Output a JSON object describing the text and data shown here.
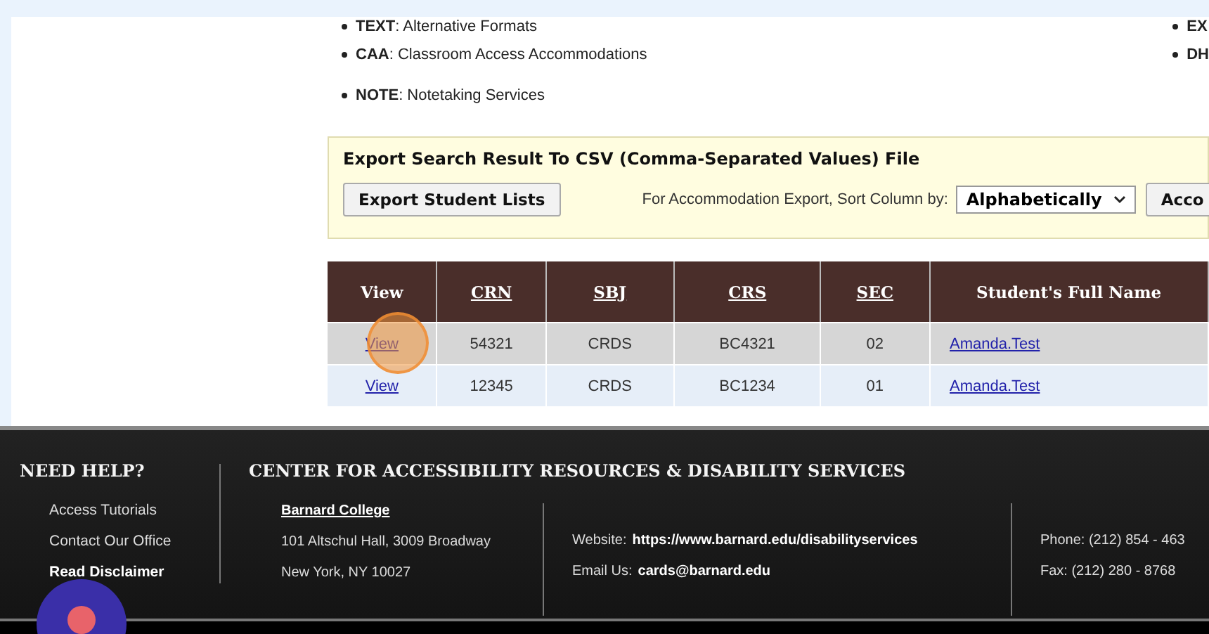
{
  "legend": {
    "left": [
      {
        "text": "**TEXT**: Alternative Formats"
      },
      {
        "text": "**CAA**: Classroom Access Accommodations"
      },
      {
        "text": "**NOTE**: Notetaking Services"
      }
    ],
    "right": [
      {
        "code": "EX"
      },
      {
        "code": "DH"
      }
    ]
  },
  "export": {
    "title": "Export Search Result To CSV (Comma-Separated Values) File",
    "button": "Export Student Lists",
    "sort_label": "For Accommodation Export, Sort Column by:",
    "sort_value": "Alphabetically",
    "button_2": "Acco"
  },
  "table": {
    "columns": [
      {
        "label": "View",
        "sortable": false
      },
      {
        "label": "CRN",
        "sortable": true
      },
      {
        "label": "SBJ",
        "sortable": true
      },
      {
        "label": "CRS",
        "sortable": true
      },
      {
        "label": "SEC",
        "sortable": true
      },
      {
        "label": "Student's Full Name",
        "sortable": false
      }
    ],
    "rows": [
      {
        "view": "View",
        "crn": "54321",
        "sbj": "CRDS",
        "crs": "BC4321",
        "sec": "02",
        "name": "Amanda.Test",
        "selected": true
      },
      {
        "view": "View",
        "crn": "12345",
        "sbj": "CRDS",
        "crs": "BC1234",
        "sec": "01",
        "name": "Amanda.Test",
        "selected": false
      }
    ]
  },
  "footer": {
    "help_title": "NEED HELP?",
    "help_links": [
      {
        "label": "Access Tutorials",
        "bold": false
      },
      {
        "label": "Contact Our Office",
        "bold": false
      },
      {
        "label": "Read Disclaimer",
        "bold": true
      }
    ],
    "center_title": "CENTER FOR ACCESSIBILITY RESOURCES & DISABILITY SERVICES",
    "college": "Barnard College",
    "address": [
      "101 Altschul Hall, 3009 Broadway",
      "New York, NY 10027"
    ],
    "website_label": "Website:",
    "website": "https://www.barnard.edu/disabilityservices",
    "email_label": "Email Us:",
    "email": "cards@barnard.edu",
    "phone": "Phone: (212) 854 - 463",
    "fax": "Fax: (212) 280 - 8768"
  }
}
